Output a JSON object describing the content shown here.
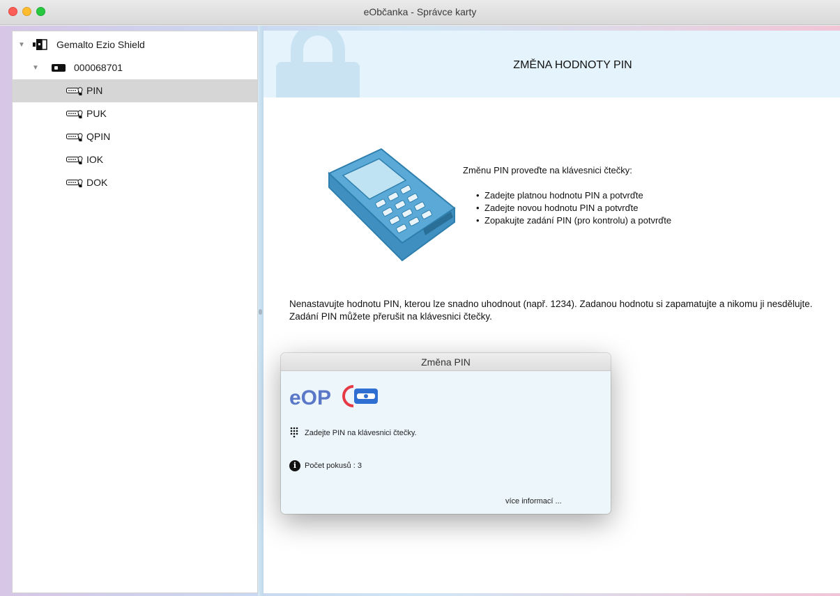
{
  "window": {
    "title": "eObčanka - Správce karty"
  },
  "sidebar": {
    "tree": {
      "reader": {
        "label": "Gemalto Ezio Shield",
        "expanded": true
      },
      "card": {
        "label": "000068701",
        "expanded": true
      },
      "items": [
        {
          "label": "PIN",
          "selected": true
        },
        {
          "label": "PUK",
          "selected": false
        },
        {
          "label": "QPIN",
          "selected": false
        },
        {
          "label": "IOK",
          "selected": false
        },
        {
          "label": "DOK",
          "selected": false
        }
      ]
    }
  },
  "main": {
    "banner_title": "ZMĚNA HODNOTY PIN",
    "instruction_intro": "Změnu PIN proveďte na klávesnici čtečky:",
    "steps": [
      "Zadejte platnou hodnotu PIN a potvrďte",
      "Zadejte novou hodnotu PIN a potvrďte",
      "Zopakujte zadání PIN (pro kontrolu) a potvrďte"
    ],
    "warning_line1": "Nenastavujte hodnotu PIN, kterou lze snadno uhodnout (např. 1234). Zadanou hodnotu si zapamatujte a nikomu ji nesdělujte.",
    "warning_line2": "Zadání PIN můžete přerušit na klávesnici čtečky."
  },
  "dialog": {
    "title": "Změna PIN",
    "logo_text": "eOP",
    "prompt": "Zadejte PIN na klávesnici čtečky.",
    "attempts": "Počet pokusů : 3",
    "more_info": "více informací ..."
  },
  "colors": {
    "banner_bg": "#e5f4fc",
    "logo_blue": "#5b78c8",
    "logo_red": "#e63946",
    "selected_row": "#d6d6d6"
  }
}
